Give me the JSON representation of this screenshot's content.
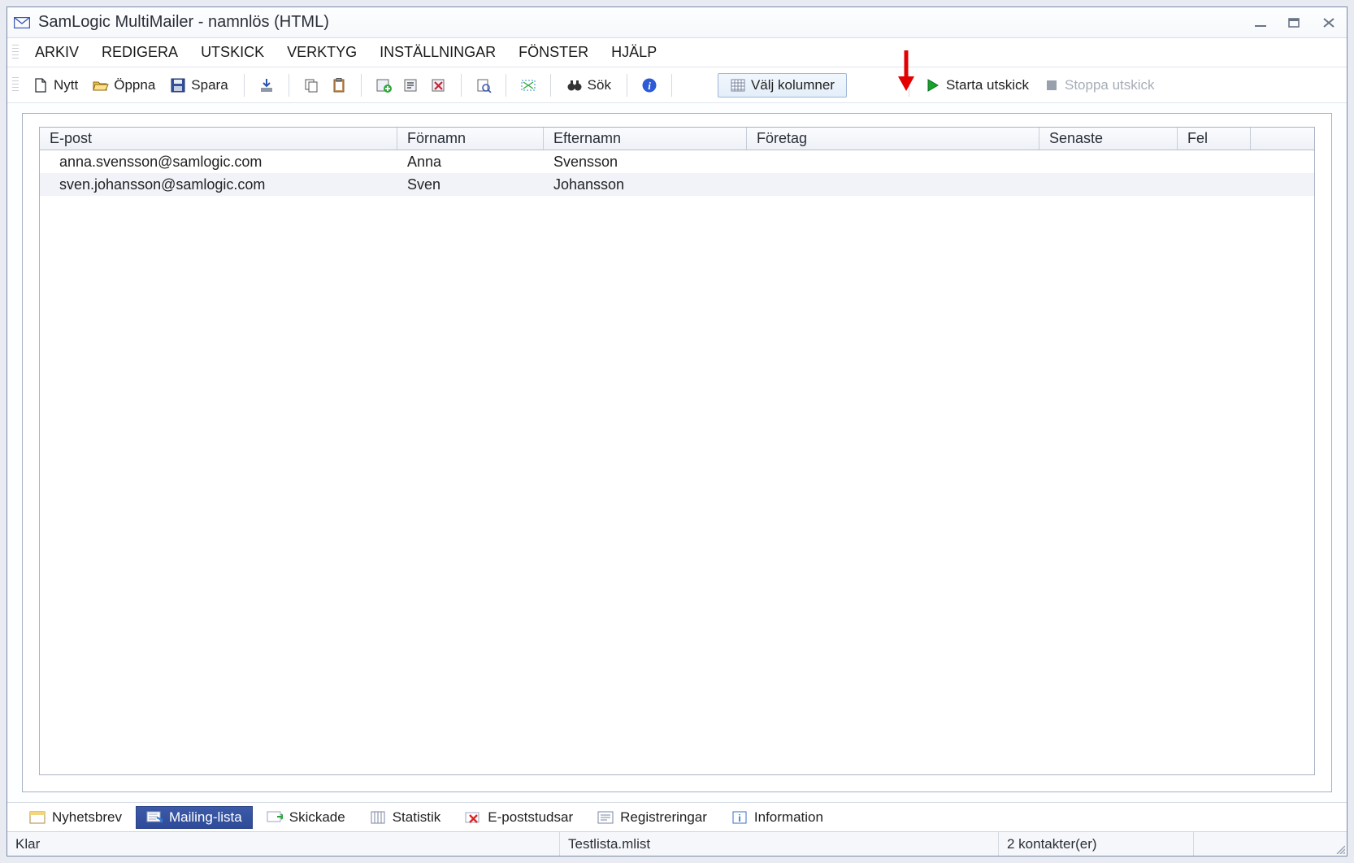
{
  "title": "SamLogic MultiMailer - namnlös  (HTML)",
  "menu": {
    "arkiv": "ARKIV",
    "redigera": "REDIGERA",
    "utskick": "UTSKICK",
    "verktyg": "VERKTYG",
    "installningar": "INSTÄLLNINGAR",
    "fonster": "FÖNSTER",
    "hjalp": "HJÄLP"
  },
  "toolbar": {
    "nytt": "Nytt",
    "oppna": "Öppna",
    "spara": "Spara",
    "sok": "Sök",
    "valj_kolumner": "Välj kolumner",
    "starta_utskick": "Starta utskick",
    "stoppa_utskick": "Stoppa utskick"
  },
  "grid": {
    "columns": {
      "epost": "E-post",
      "fornamn": "Förnamn",
      "efternamn": "Efternamn",
      "foretag": "Företag",
      "senaste": "Senaste",
      "fel": "Fel"
    },
    "rows": [
      {
        "email": "anna.svensson@samlogic.com",
        "fn": "Anna",
        "ln": "Svensson",
        "co": "",
        "last": "",
        "err": ""
      },
      {
        "email": "sven.johansson@samlogic.com",
        "fn": "Sven",
        "ln": "Johansson",
        "co": "",
        "last": "",
        "err": ""
      }
    ]
  },
  "tabs": {
    "nyhetsbrev": "Nyhetsbrev",
    "mailing": "Mailing-lista",
    "skickade": "Skickade",
    "statistik": "Statistik",
    "epoststudsar": "E-poststudsar",
    "registreringar": "Registreringar",
    "information": "Information"
  },
  "status": {
    "left": "Klar",
    "file": "Testlista.mlist",
    "count": "2 kontakter(er)"
  }
}
